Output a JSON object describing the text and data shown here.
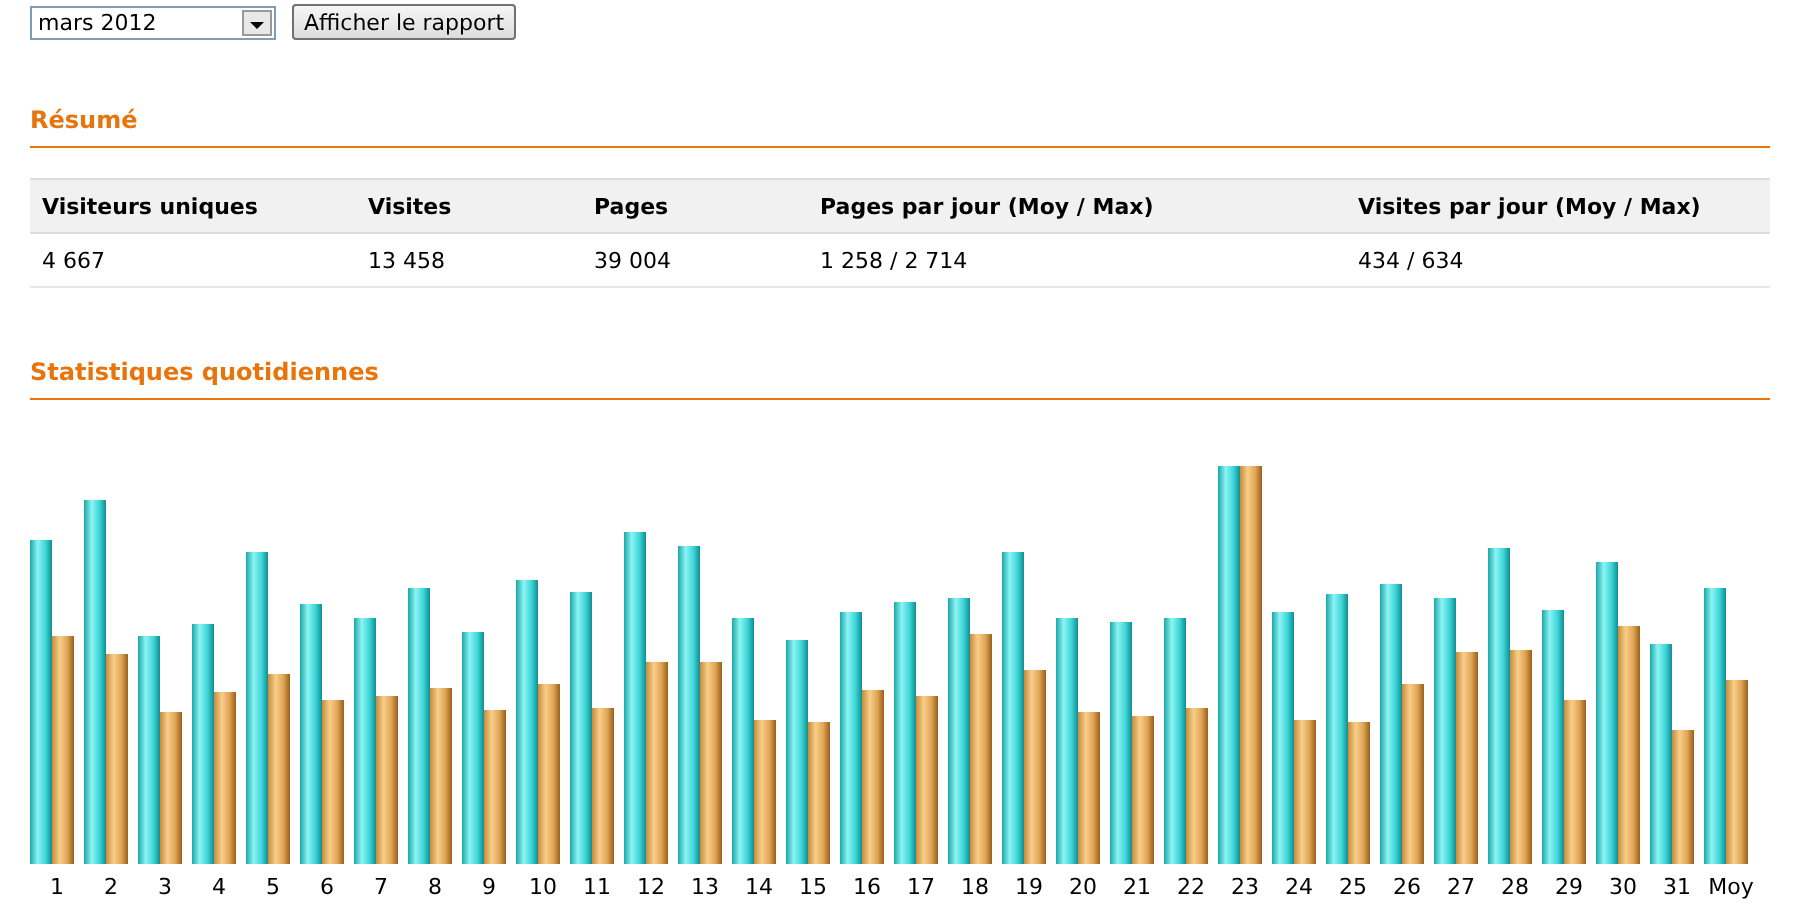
{
  "period_select": {
    "value": "mars 2012"
  },
  "report_button": {
    "label": "Afficher le rapport"
  },
  "summary": {
    "title": "Résumé",
    "columns": [
      "Visiteurs uniques",
      "Visites",
      "Pages",
      "Pages par jour (Moy / Max)",
      "Visites par jour (Moy / Max)"
    ],
    "rows": [
      [
        "4 667",
        "13 458",
        "39 004",
        "1 258 / 2 714",
        "434 / 634"
      ]
    ]
  },
  "daily_stats": {
    "title": "Statistiques quotidiennes",
    "day_labels": [
      "1",
      "2",
      "3",
      "4",
      "5",
      "6",
      "7",
      "8",
      "9",
      "10",
      "11",
      "12",
      "13",
      "14",
      "15",
      "16",
      "17",
      "18",
      "19",
      "20",
      "21",
      "22",
      "23",
      "24",
      "25",
      "26",
      "27",
      "28",
      "29",
      "30",
      "31",
      "Moy"
    ]
  }
}
